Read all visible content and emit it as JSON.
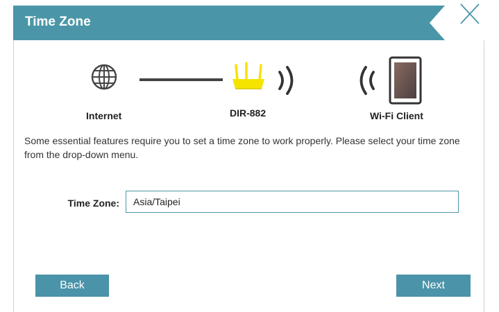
{
  "header": {
    "title": "Time Zone",
    "bar_color": "#4a96a8"
  },
  "close": {
    "icon": "close-icon",
    "color": "#4a96a8"
  },
  "diagram": {
    "internet": {
      "icon": "globe-icon",
      "label": "Internet"
    },
    "router": {
      "icon": "router-icon",
      "label": "DIR-882",
      "color": "#f5e400"
    },
    "client": {
      "icon": "tablet-icon",
      "label": "Wi-Fi Client"
    }
  },
  "description": "Some essential features require you to set a time zone to work properly. Please select your time zone from the drop-down menu.",
  "form": {
    "time_zone_label": "Time Zone:",
    "time_zone_value": "Asia/Taipei"
  },
  "buttons": {
    "back": "Back",
    "next": "Next",
    "color": "#4a93a8"
  }
}
